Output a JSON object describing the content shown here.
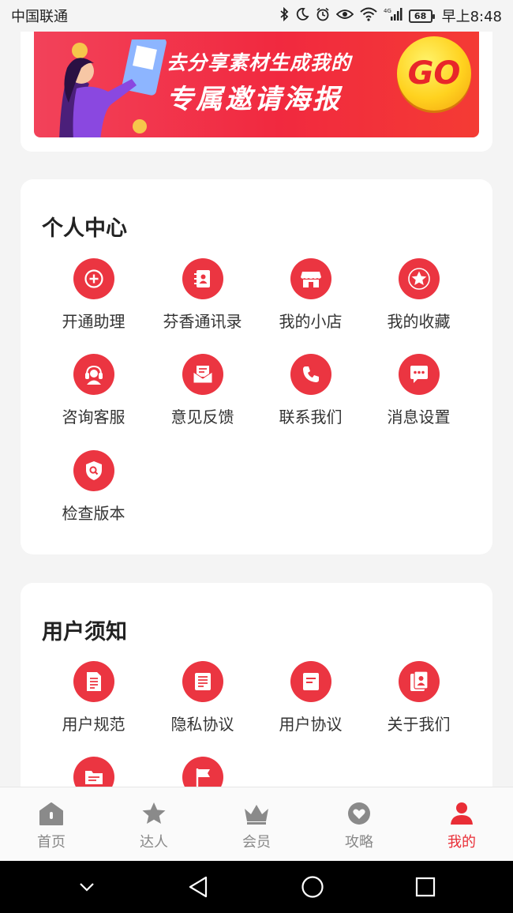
{
  "status_bar": {
    "carrier": "中国联通",
    "battery": "68",
    "time": "早上8:48"
  },
  "banner": {
    "line1": "去分享素材生成我的",
    "line2": "专属邀请海报",
    "go_label": "GO"
  },
  "personal_center": {
    "title": "个人中心",
    "items": [
      {
        "label": "开通助理",
        "icon": "plus-circle-icon"
      },
      {
        "label": "芬香通讯录",
        "icon": "contact-book-icon"
      },
      {
        "label": "我的小店",
        "icon": "store-icon"
      },
      {
        "label": "我的收藏",
        "icon": "star-icon"
      },
      {
        "label": "咨询客服",
        "icon": "headset-icon"
      },
      {
        "label": "意见反馈",
        "icon": "envelope-icon"
      },
      {
        "label": "联系我们",
        "icon": "phone-icon"
      },
      {
        "label": "消息设置",
        "icon": "chat-bubble-icon"
      },
      {
        "label": "检查版本",
        "icon": "shield-search-icon"
      }
    ]
  },
  "user_notice": {
    "title": "用户须知",
    "items": [
      {
        "label": "用户规范",
        "icon": "document-icon"
      },
      {
        "label": "隐私协议",
        "icon": "list-document-icon"
      },
      {
        "label": "用户协议",
        "icon": "agreement-icon"
      },
      {
        "label": "关于我们",
        "icon": "about-icon"
      },
      {
        "label": "",
        "icon": "folder-icon"
      },
      {
        "label": "",
        "icon": "flag-icon"
      }
    ]
  },
  "bottom_nav": {
    "items": [
      {
        "label": "首页",
        "icon": "home-icon"
      },
      {
        "label": "达人",
        "icon": "star-icon"
      },
      {
        "label": "会员",
        "icon": "crown-icon"
      },
      {
        "label": "攻略",
        "icon": "heart-icon"
      },
      {
        "label": "我的",
        "icon": "user-icon"
      }
    ],
    "active_color": "#e92d36",
    "inactive_color": "#888888"
  },
  "colors": {
    "accent": "#eb3541",
    "background": "#f4f4f4"
  }
}
